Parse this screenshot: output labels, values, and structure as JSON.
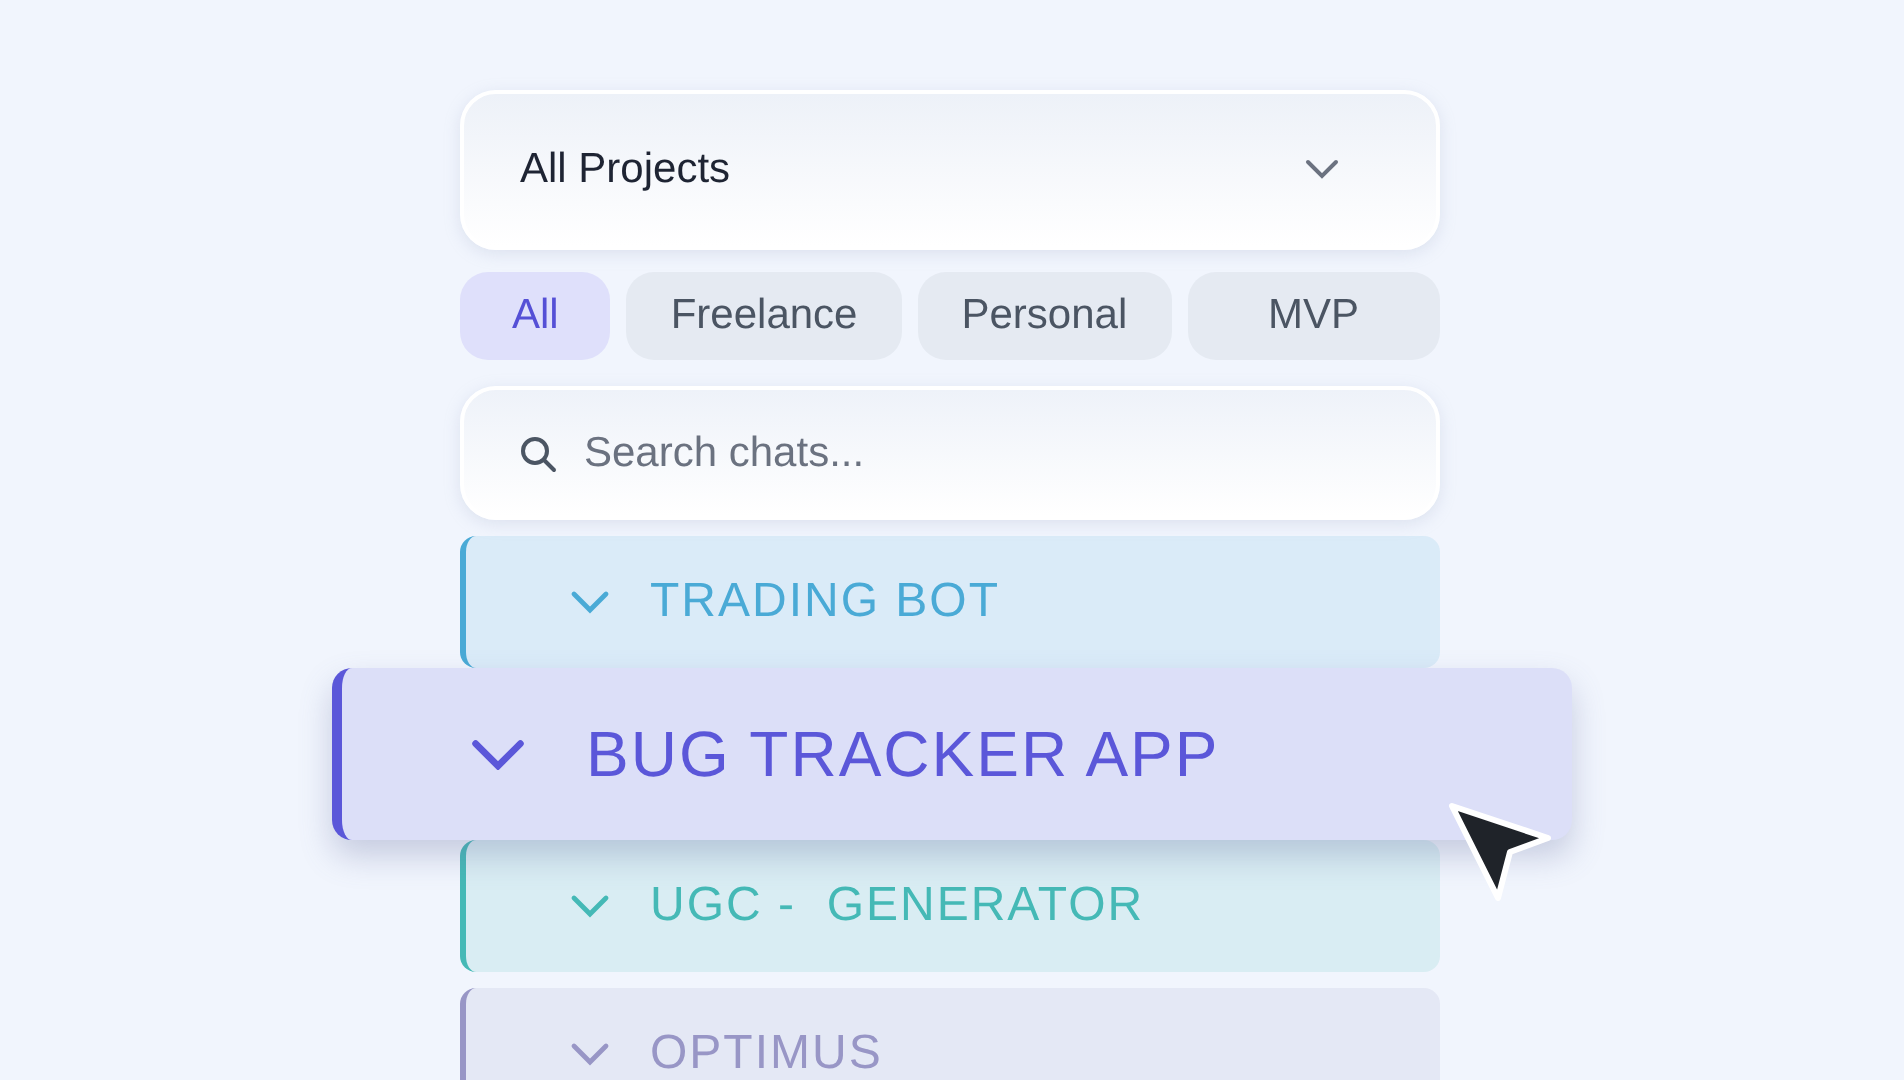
{
  "project_filter": {
    "value": "All Projects"
  },
  "chips": [
    {
      "label": "All",
      "selected": true
    },
    {
      "label": "Freelance",
      "selected": false
    },
    {
      "label": "Personal",
      "selected": false
    },
    {
      "label": "MVP",
      "selected": false
    }
  ],
  "search": {
    "placeholder": "Search chats..."
  },
  "projects": [
    {
      "name": "TRADING BOT",
      "color": "#4aaad6",
      "selected": false
    },
    {
      "name": "BUG TRACKER APP",
      "color": "#5b57d9",
      "selected": true
    },
    {
      "name": "UGC -  GENERATOR",
      "color": "#45b9b6",
      "selected": false
    },
    {
      "name": "OPTIMUS",
      "color": "#9896c6",
      "selected": false
    }
  ]
}
